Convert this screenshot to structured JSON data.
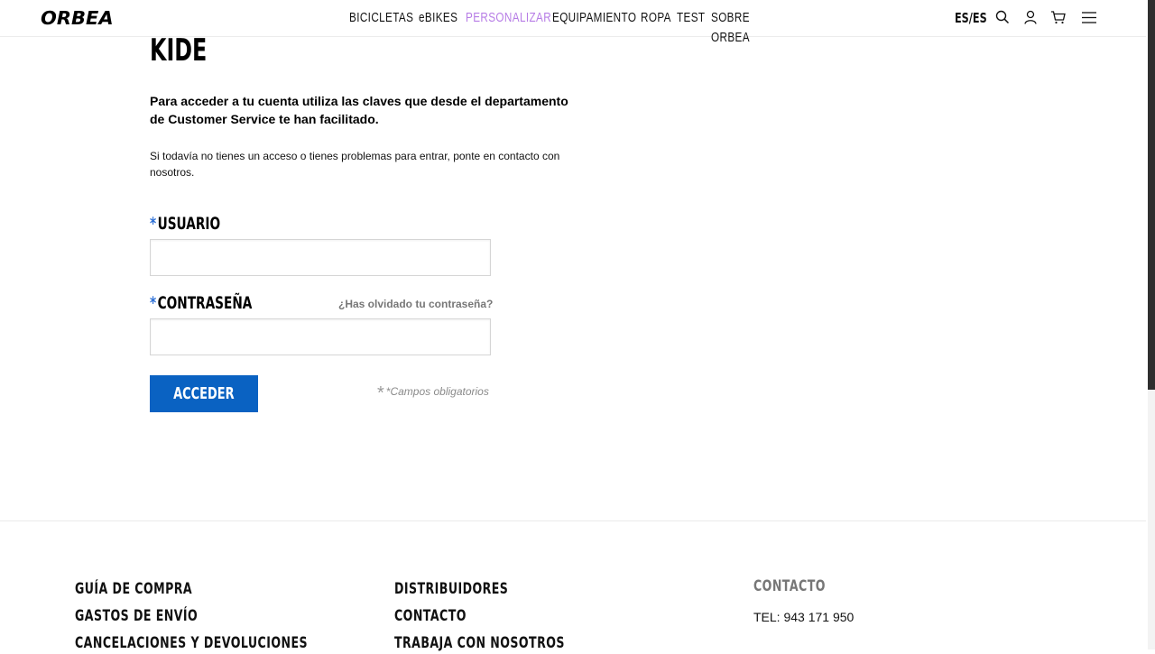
{
  "header": {
    "logo": "ORBEA",
    "nav": [
      {
        "label": "BICICLETAS",
        "active": false
      },
      {
        "label": "eBIKES",
        "active": false
      },
      {
        "label": "PERSONALIZAR",
        "active": true
      },
      {
        "label": "EQUIPAMIENTO",
        "active": false
      },
      {
        "label": "ROPA",
        "active": false
      },
      {
        "label": "TEST",
        "active": false
      },
      {
        "label": "SOBRE ORBEA",
        "active": false
      }
    ],
    "language": "ES/ES",
    "icons": [
      "search-icon",
      "user-icon",
      "cart-icon",
      "menu-icon"
    ]
  },
  "main": {
    "title": "KIDE",
    "intro": "Para acceder a tu cuenta utiliza las claves que desde el departamento de Customer Service te han facilitado.",
    "help": "Si todavía no tienes un acceso o tienes problemas para entrar, ponte en contacto con nosotros.",
    "username_label": "USUARIO",
    "username_value": "",
    "password_label": "CONTRASEÑA",
    "password_value": "",
    "forgot_link": "¿Has olvidado tu contraseña?",
    "required_marker": "*",
    "submit_label": "ACCEDER",
    "mandatory_note": "*Campos obligatorios"
  },
  "footer": {
    "col1": [
      "GUÍA DE COMPRA",
      "GASTOS DE ENVÍO",
      "CANCELACIONES Y DEVOLUCIONES"
    ],
    "col2": [
      "DISTRIBUIDORES",
      "CONTACTO",
      "TRABAJA CON NOSOTROS"
    ],
    "contact_heading": "CONTACTO",
    "contact_tel": "TEL: 943 171 950"
  },
  "colors": {
    "accent_nav": "#b77de6",
    "button": "#0a62c2",
    "required": "#2c6fd6"
  }
}
